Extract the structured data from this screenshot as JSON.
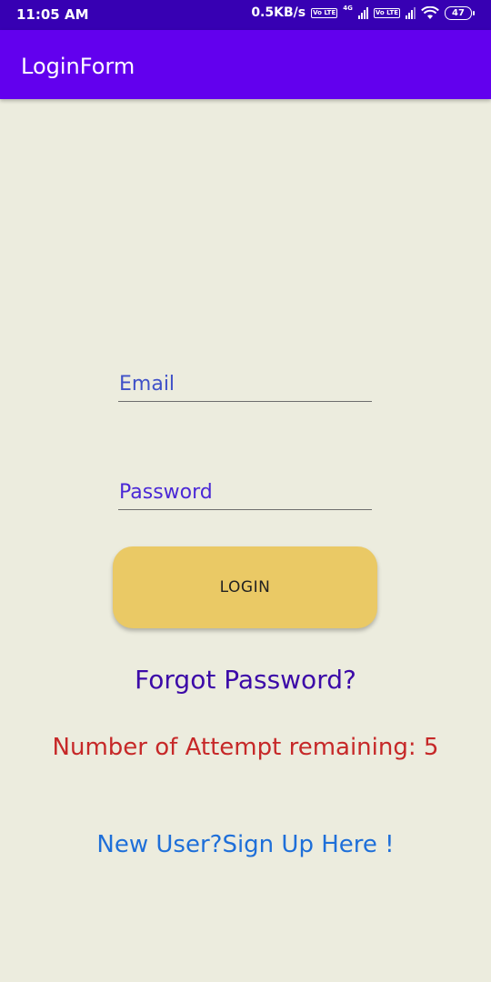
{
  "status_bar": {
    "time": "11:05 AM",
    "network_speed": "0.5KB/s",
    "volte_label_1": "Vo LTE",
    "network_type": "4G",
    "volte_label_2": "Vo LTE",
    "battery_level": "47"
  },
  "app_bar": {
    "title": "LoginForm"
  },
  "form": {
    "email_placeholder": "Email",
    "email_value": "",
    "password_placeholder": "Password",
    "password_value": "",
    "login_label": "LOGIN"
  },
  "links": {
    "forgot_password": "Forgot Password?",
    "signup": "New User?Sign Up Here !"
  },
  "attempts_text": "Number of Attempt remaining: 5",
  "colors": {
    "status_bar": "#3700B3",
    "app_bar": "#6200EE",
    "background": "#ECECDE",
    "login_button": "#EAC965",
    "forgot_link": "#3C0AA8",
    "attempts_text": "#C62828",
    "signup_link": "#1E6FD9"
  }
}
